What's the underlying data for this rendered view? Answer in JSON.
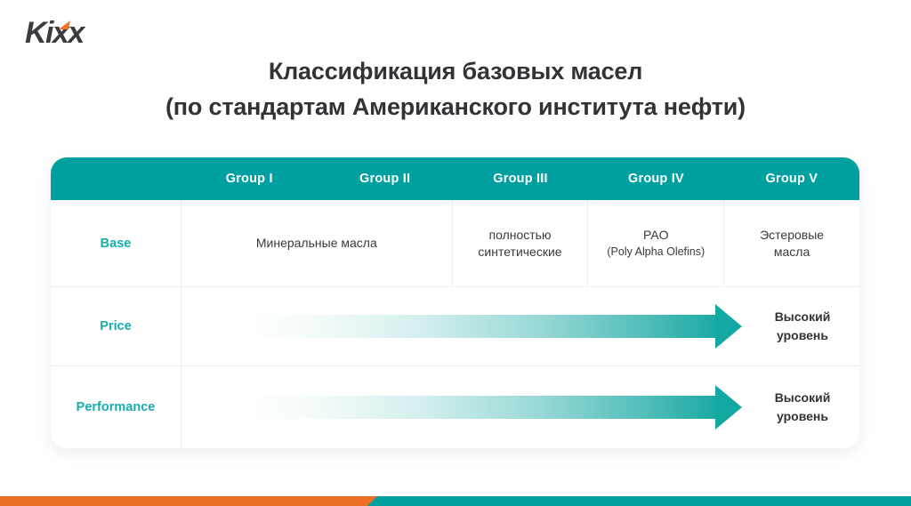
{
  "brand": {
    "logo_text": "Kixx",
    "logo_color": "#3b3b40",
    "accent_color": "#ef7622"
  },
  "title": {
    "line1": "Классификация базовых масел",
    "line2": "(по стандартам Американского института нефти)"
  },
  "theme": {
    "teal": "#00a0a0",
    "teal_label": "#18adad",
    "arrow_teal": "#14a8a2",
    "orange": "#ec7024",
    "text_dark": "#333337",
    "divider": "#eceef0"
  },
  "table": {
    "columns": [
      {
        "label": "Group I"
      },
      {
        "label": "Group II"
      },
      {
        "label": "Group III"
      },
      {
        "label": "Group IV"
      },
      {
        "label": "Group V"
      }
    ],
    "rows": [
      {
        "label": "Base",
        "type": "cells",
        "cells": [
          {
            "text": "Минеральные масла",
            "span": 2
          },
          {
            "text": "полностью\nсинтетические",
            "span": 1
          },
          {
            "text": "PAO",
            "sub": "(Poly Alpha Olefins)",
            "span": 1
          },
          {
            "text": "Эстеровые\nмасла",
            "span": 1
          }
        ]
      },
      {
        "label": "Price",
        "type": "arrow",
        "arrow_label": "Высокий\nуровень"
      },
      {
        "label": "Performance",
        "type": "arrow",
        "arrow_label": "Высокий\nуровень"
      }
    ]
  },
  "footer": {
    "left_color": "#ec7024",
    "right_color": "#00a0a0"
  }
}
